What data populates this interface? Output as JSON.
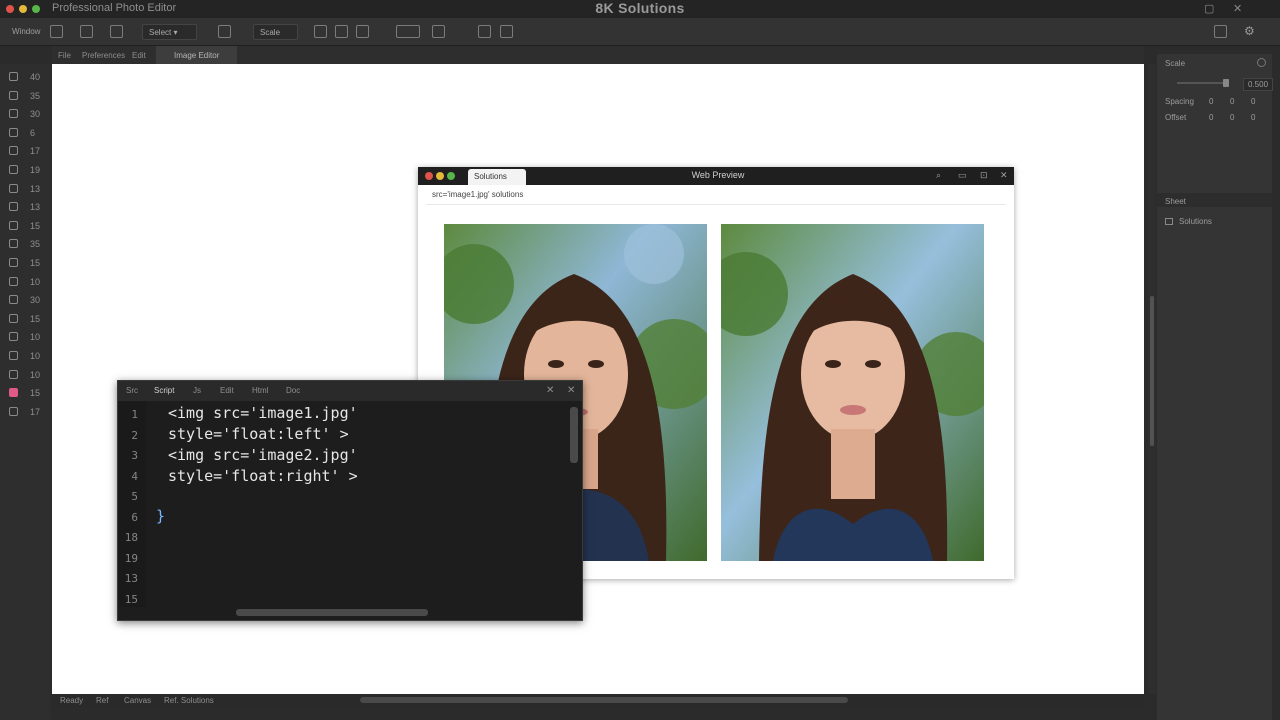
{
  "window": {
    "app_title": "Professional Photo Editor",
    "brand": "8K Solutions",
    "controls": [
      "▢",
      "✕"
    ]
  },
  "toolbar": {
    "menu_label": "Window",
    "dropdown_label": "Select ▾",
    "zoom_label": "Scale",
    "right_icons": [
      "gear-icon",
      "window-icon"
    ]
  },
  "doc_tabs": [
    "File",
    "Preferences",
    "Edit",
    "Image Editor"
  ],
  "left_tools": [
    {
      "icon": "move-icon",
      "value": "40"
    },
    {
      "icon": "lasso-icon",
      "value": "35"
    },
    {
      "icon": "brush-icon",
      "value": "30"
    },
    {
      "icon": "crop-icon",
      "value": "6"
    },
    {
      "icon": "eyedropper-icon",
      "value": "17"
    },
    {
      "icon": "pen-icon",
      "value": "19"
    },
    {
      "icon": "stamp-icon",
      "value": "13"
    },
    {
      "icon": "eraser-icon",
      "value": "13"
    },
    {
      "icon": "bucket-icon",
      "value": "15"
    },
    {
      "icon": "shape-icon",
      "value": "35"
    },
    {
      "icon": "text-icon",
      "value": "15"
    },
    {
      "icon": "hand-icon",
      "value": "10"
    },
    {
      "icon": "zoom-icon",
      "value": "30"
    },
    {
      "icon": "type-icon",
      "value": "15"
    },
    {
      "icon": "select-icon",
      "value": "10"
    },
    {
      "icon": "path-icon",
      "value": "10"
    },
    {
      "icon": "blur-icon",
      "value": "10"
    },
    {
      "icon": "smudge-icon",
      "value": "15"
    },
    {
      "icon": "dodge-icon",
      "value": "17"
    }
  ],
  "browser": {
    "tab_label": "Solutions",
    "title": "Web Preview",
    "url": "src='image1.jpg'   solutions",
    "controls": [
      "⌕",
      "▭",
      "⊡",
      "✕"
    ]
  },
  "editor": {
    "tabs": [
      "Src",
      "Script",
      "Js",
      "Edit",
      "Html",
      "Doc"
    ],
    "line_numbers": [
      "1",
      "2",
      "3",
      "4",
      "5",
      "6",
      "18",
      "19",
      "13",
      "15"
    ],
    "code_lines": [
      "<img src='image1.jpg'",
      "style='float:left' >",
      "<img src='image2.jpg'",
      "style='float:right' >"
    ],
    "brace": "}",
    "close_icons": [
      "✕",
      "✕"
    ]
  },
  "right_panel": {
    "section1_title": "Scale",
    "scale_value": "0.500",
    "rows": [
      {
        "label": "Spacing",
        "value": "0"
      },
      {
        "label": "Offset",
        "value": "0"
      }
    ],
    "section2_title": "Sheet",
    "item_label": "Solutions"
  },
  "status": {
    "items": [
      "Ready",
      "Ref",
      "Canvas",
      "Ref. Solutions"
    ]
  },
  "colors": {
    "accent": "#e05a86",
    "code_brace": "#79b8ff",
    "canvas": "#ffffff",
    "chrome": "#2b2b2b"
  }
}
